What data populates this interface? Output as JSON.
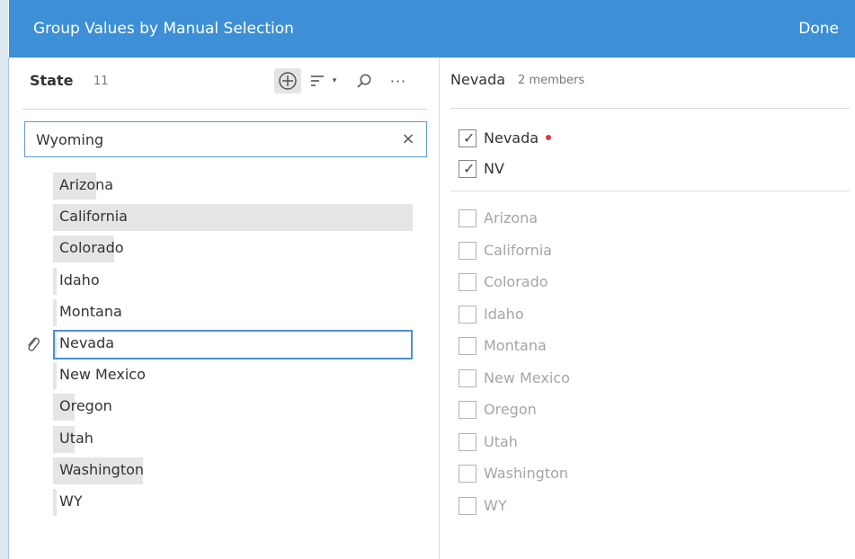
{
  "window": {
    "title": "Group Values by Manual Selection",
    "done_label": "Done"
  },
  "left": {
    "field_name": "State",
    "field_count": "11",
    "search": {
      "value": "Wyoming",
      "clear_symbol": "×"
    },
    "toolbar": {
      "more_symbol": "···",
      "caret_symbol": "▾"
    },
    "items": [
      {
        "label": "Arizona",
        "bar": 0.12
      },
      {
        "label": "California",
        "bar": 1.0
      },
      {
        "label": "Colorado",
        "bar": 0.17
      },
      {
        "label": "Idaho",
        "bar": 0.01
      },
      {
        "label": "Montana",
        "bar": 0.01
      },
      {
        "label": "Nevada",
        "bar": 0.01,
        "selected": true,
        "clip": true
      },
      {
        "label": "New Mexico",
        "bar": 0.01
      },
      {
        "label": "Oregon",
        "bar": 0.06
      },
      {
        "label": "Utah",
        "bar": 0.06
      },
      {
        "label": "Washington",
        "bar": 0.25
      },
      {
        "label": "WY",
        "bar": 0.01
      }
    ]
  },
  "right": {
    "group_name": "Nevada",
    "members_label": "2 members",
    "checked": [
      {
        "label": "Nevada",
        "dot": true
      },
      {
        "label": "NV"
      }
    ],
    "unchecked": [
      {
        "label": "Arizona"
      },
      {
        "label": "California"
      },
      {
        "label": "Colorado"
      },
      {
        "label": "Idaho"
      },
      {
        "label": "Montana"
      },
      {
        "label": "New Mexico"
      },
      {
        "label": "Oregon"
      },
      {
        "label": "Utah"
      },
      {
        "label": "Washington"
      },
      {
        "label": "WY"
      }
    ],
    "check_symbol": "✓"
  },
  "colors": {
    "accent": "#3d8fd6",
    "selection_border": "#4a8fd4",
    "bar_fill": "#e5e5e5",
    "modified_dot": "#e0393e"
  }
}
